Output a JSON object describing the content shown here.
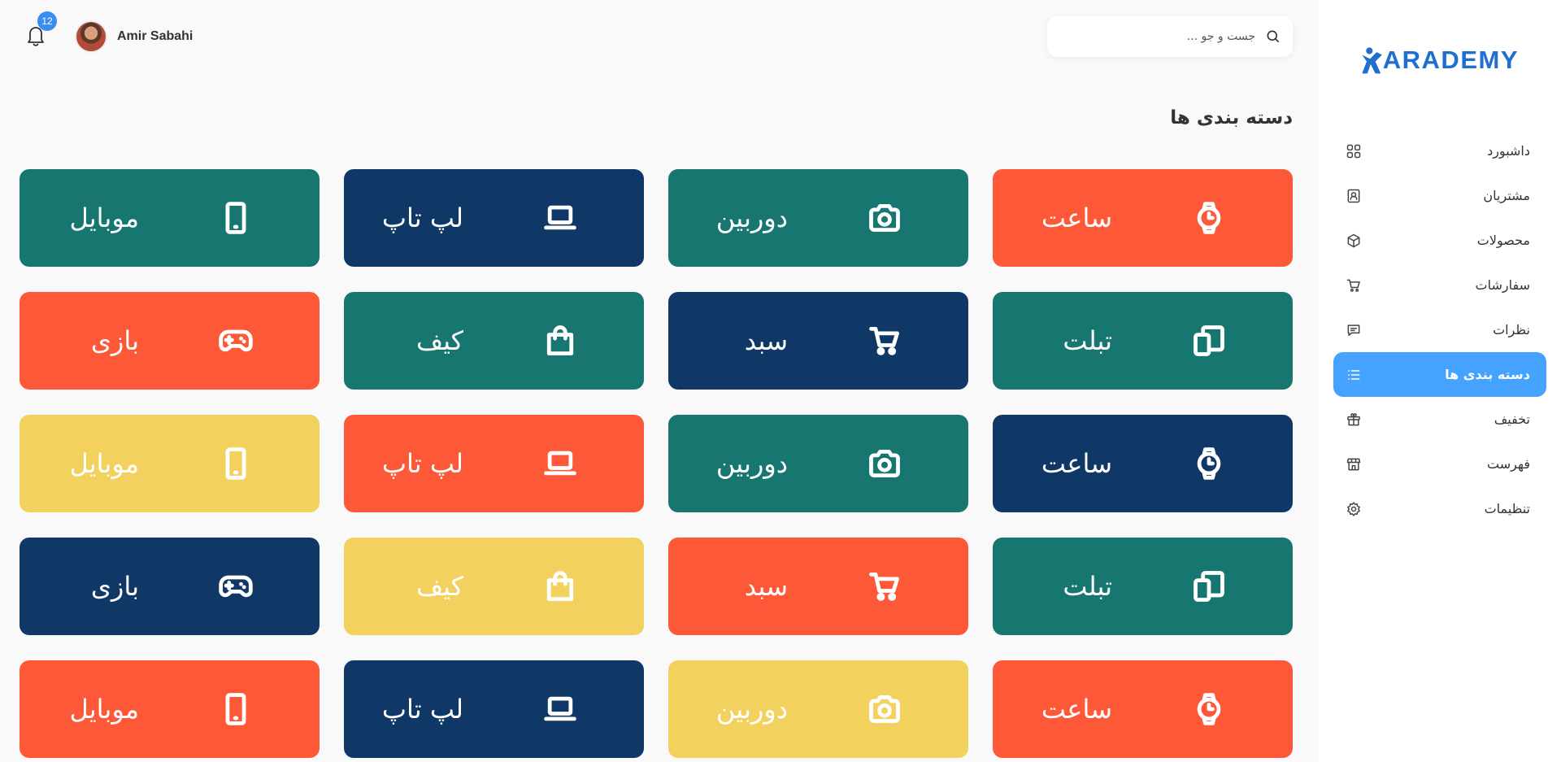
{
  "brand": {
    "logo_text": "ARADEMY",
    "logo_icon": "person-k-icon",
    "color": "#1e6fd0"
  },
  "sidebar": {
    "items": [
      {
        "label": "داشبورد",
        "icon": "dashboard-grid-icon"
      },
      {
        "label": "مشتریان",
        "icon": "contacts-icon"
      },
      {
        "label": "محصولات",
        "icon": "box-icon"
      },
      {
        "label": "سفارشات",
        "icon": "cart-icon"
      },
      {
        "label": "نظرات",
        "icon": "comment-icon"
      },
      {
        "label": "دسته بندی ها",
        "icon": "list-icon",
        "active": true
      },
      {
        "label": "تخفیف",
        "icon": "gift-icon"
      },
      {
        "label": "فهرست",
        "icon": "store-icon"
      },
      {
        "label": "تنظیمات",
        "icon": "settings-gear-icon"
      }
    ],
    "active_color": "#45a2ff"
  },
  "search": {
    "placeholder": "جست و جو ...",
    "value": ""
  },
  "user": {
    "name": "Amir Sabahi",
    "notifications": "12"
  },
  "page_title": "دسته بندی ها",
  "colors": {
    "orange": "#fd5837",
    "teal": "#177670",
    "navy": "#0f3866",
    "yellow": "#f3d15f"
  },
  "categories": [
    {
      "label": "ساعت",
      "icon": "watch-icon",
      "color": "orange"
    },
    {
      "label": "دوربین",
      "icon": "camera-icon",
      "color": "teal"
    },
    {
      "label": "لپ تاپ",
      "icon": "laptop-icon",
      "color": "navy"
    },
    {
      "label": "موبایل",
      "icon": "mobile-icon",
      "color": "teal"
    },
    {
      "label": "تبلت",
      "icon": "tablet-icon",
      "color": "teal"
    },
    {
      "label": "سبد",
      "icon": "cart-icon",
      "color": "navy"
    },
    {
      "label": "کیف",
      "icon": "bag-icon",
      "color": "teal"
    },
    {
      "label": "بازی",
      "icon": "gamepad-icon",
      "color": "orange"
    },
    {
      "label": "ساعت",
      "icon": "watch-icon",
      "color": "navy"
    },
    {
      "label": "دوربین",
      "icon": "camera-icon",
      "color": "teal"
    },
    {
      "label": "لپ تاپ",
      "icon": "laptop-icon",
      "color": "orange"
    },
    {
      "label": "موبایل",
      "icon": "mobile-icon",
      "color": "yellow"
    },
    {
      "label": "تبلت",
      "icon": "tablet-icon",
      "color": "teal"
    },
    {
      "label": "سبد",
      "icon": "cart-icon",
      "color": "orange"
    },
    {
      "label": "کیف",
      "icon": "bag-icon",
      "color": "yellow"
    },
    {
      "label": "بازی",
      "icon": "gamepad-icon",
      "color": "navy"
    },
    {
      "label": "ساعت",
      "icon": "watch-icon",
      "color": "orange"
    },
    {
      "label": "دوربین",
      "icon": "camera-icon",
      "color": "yellow"
    },
    {
      "label": "لپ تاپ",
      "icon": "laptop-icon",
      "color": "navy"
    },
    {
      "label": "موبایل",
      "icon": "mobile-icon",
      "color": "orange"
    }
  ]
}
